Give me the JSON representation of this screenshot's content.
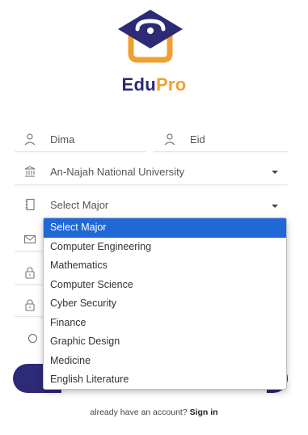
{
  "brand": {
    "edu": "Edu",
    "pro": "Pro"
  },
  "form": {
    "first_name": "Dima",
    "last_name": "Eid",
    "university": "An-Najah National University",
    "major": "Select Major"
  },
  "major_options": [
    "Select Major",
    "Computer Engineering",
    "Mathematics",
    "Computer Science",
    "Cyber Security",
    "Finance",
    "Graphic Design",
    "Medicine",
    "English Literature"
  ],
  "footer": {
    "prompt": "already have an account?",
    "signin": "Sign in"
  },
  "colors": {
    "primary": "#2d2a77",
    "accent": "#f0a030",
    "selected": "#1f68d6"
  }
}
